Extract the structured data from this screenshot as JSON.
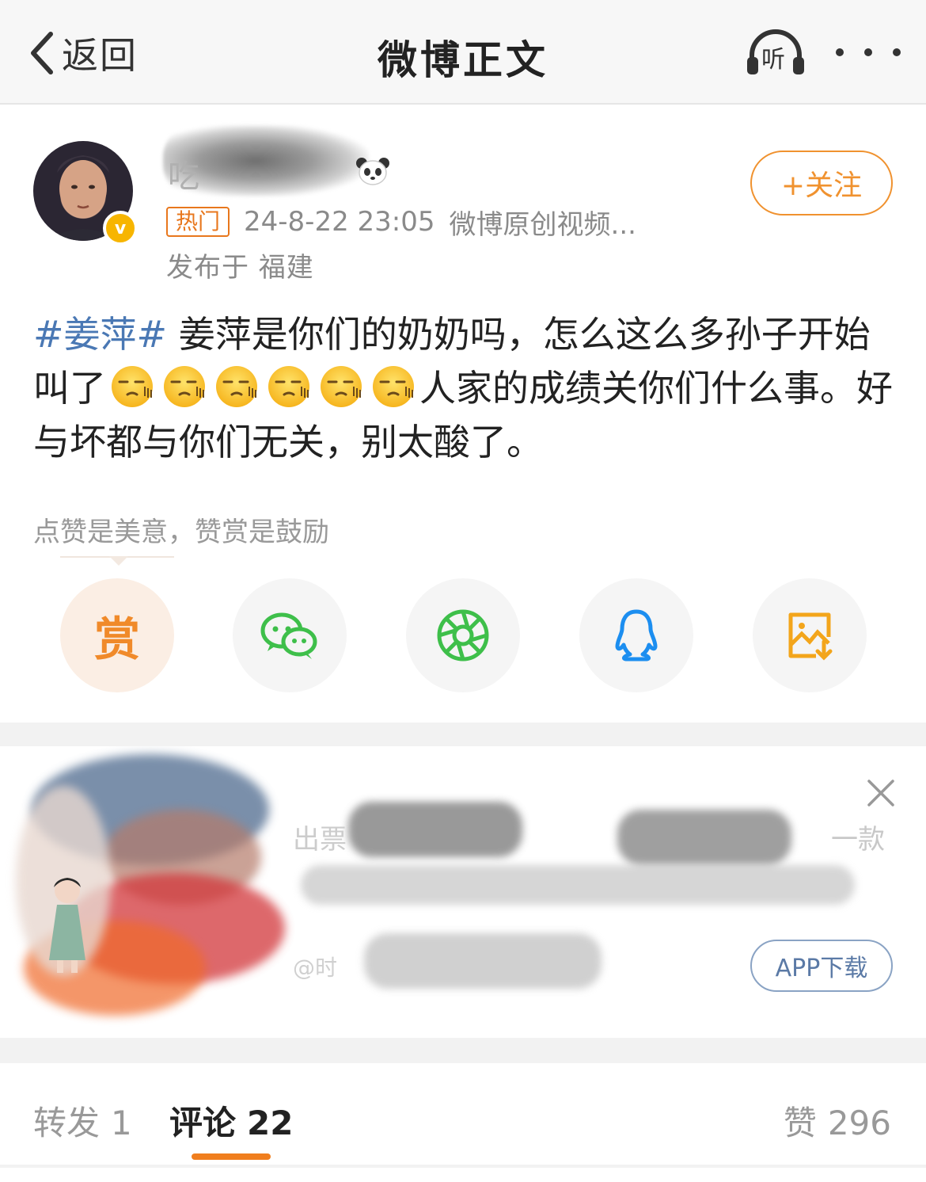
{
  "header": {
    "back_label": "返回",
    "title": "微博正文",
    "listen_label": "听"
  },
  "author": {
    "name_visible_char": "吃",
    "hot_badge": "热门",
    "timestamp": "24-8-22 23:05",
    "source": "微博原创视频...",
    "location": "发布于 福建",
    "follow_label": "+关注"
  },
  "post": {
    "hashtag": "#姜萍#",
    "text_part1": " 姜萍是你们的奶奶吗，怎么这么多孙子开始叫了",
    "emoji_count": 6,
    "emoji_name": "哼唧-emoji",
    "text_part2": "人家的成绩关你们什么事。好与坏都与你们无关，别太酸了。"
  },
  "reward": {
    "hint": "点赞是美意，赞赏是鼓励",
    "reward_label": "赏"
  },
  "share": {
    "buttons": [
      "reward-icon",
      "wechat-icon",
      "moments-icon",
      "qq-icon",
      "save-image-icon"
    ]
  },
  "ad": {
    "text_fragment_left": "出票",
    "text_fragment_right": "一款",
    "text_fragment_bottom": "@时",
    "download_label": "APP下载"
  },
  "tabs": {
    "repost_label": "转发",
    "repost_count": "1",
    "comment_label": "评论",
    "comment_count": "22",
    "like_label": "赞",
    "like_count": "296"
  },
  "colors": {
    "accent_orange": "#f0922f",
    "tag_blue": "#4a78b4",
    "wechat_green": "#3ebf4a",
    "qq_blue": "#1c8ef0",
    "save_orange": "#f3a51b"
  }
}
